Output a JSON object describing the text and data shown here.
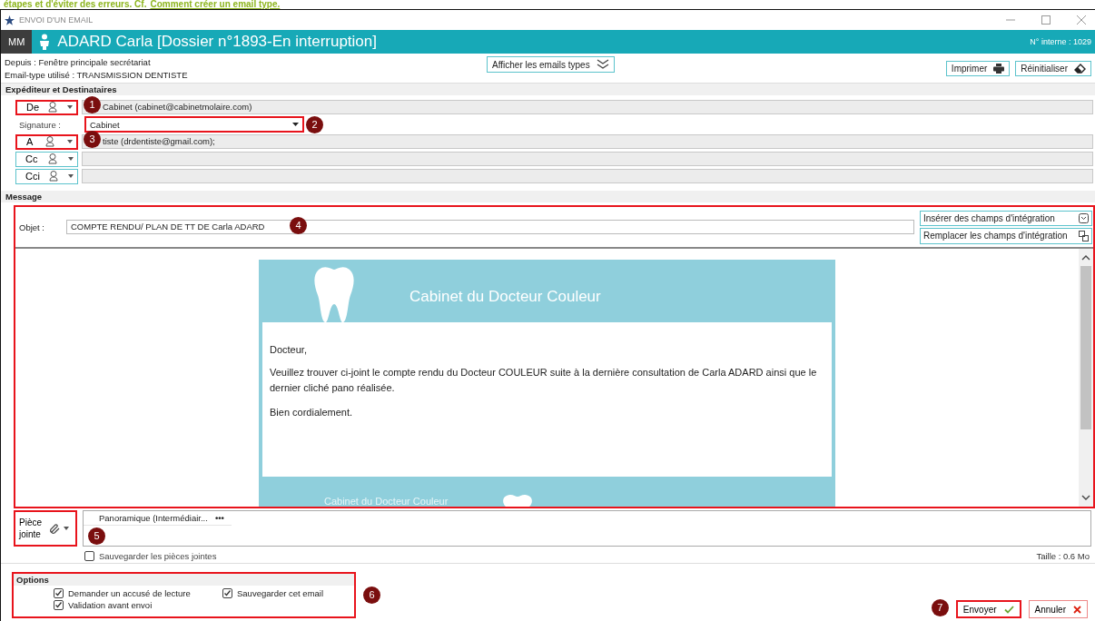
{
  "note": {
    "text": "étapes et d'éviter des erreurs. Cf.",
    "link": "Comment créer un email type."
  },
  "window": {
    "title": "ENVOI D'UN EMAIL"
  },
  "header": {
    "initials": "MM",
    "patient": "ADARD Carla [Dossier n°1893-En interruption]",
    "internal_number": "N° interne :  1029"
  },
  "info": {
    "source": "Depuis : Fenêtre principale secrétariat",
    "template": "Email-type utilisé : TRANSMISSION DENTISTE"
  },
  "toolbar": {
    "templates_button": "Afficher les emails types",
    "print_button": "Imprimer",
    "reset_button": "Réinitialiser"
  },
  "recipients": {
    "title": "Expéditeur et Destinataires",
    "rows": [
      {
        "kind": "address",
        "label": "De",
        "value": "Cabinet (cabinet@cabinetmolaire.com)",
        "highlighted": true,
        "marker": "1"
      },
      {
        "kind": "select",
        "label": "Signature :",
        "value": "Cabinet",
        "highlighted": true,
        "marker": "2"
      },
      {
        "kind": "address",
        "label": "A",
        "value": "tiste (drdentiste@gmail.com);",
        "highlighted": true,
        "marker": "3"
      },
      {
        "kind": "address",
        "label": "Cc",
        "highlighted": false
      },
      {
        "kind": "address",
        "label": "Cci",
        "highlighted": false
      }
    ]
  },
  "message": {
    "title": "Message",
    "subject_label": "Objet :",
    "subject": "COMPTE RENDU/ PLAN DE TT DE Carla ADARD",
    "marker": "4",
    "insert_button": "Insérer des champs d'intégration",
    "replace_button": "Remplacer les champs d'intégration",
    "email": {
      "banner": "Cabinet du Docteur Couleur",
      "greeting": "Docteur,",
      "body": "Veuillez trouver ci-joint le compte rendu du Docteur COULEUR suite à la dernière consultation de Carla ADARD ainsi que le dernier cliché pano réalisée.",
      "closing": "Bien cordialement.",
      "footer": "Cabinet du Docteur Couleur"
    }
  },
  "attachments": {
    "label": "Pièce jointe",
    "marker": "5",
    "files": [
      "Panoramique (Intermédiair..."
    ],
    "more": "•••",
    "save": {
      "label": "Sauvegarder les pièces jointes",
      "checked": false
    },
    "size": "Taille : 0.6 Mo"
  },
  "options": {
    "title": "Options",
    "marker": "6",
    "items": [
      {
        "label": "Demander un accusé de lecture",
        "checked": true
      },
      {
        "label": "Sauvegarder cet email",
        "checked": true
      },
      {
        "label": "Validation avant envoi",
        "checked": true
      }
    ]
  },
  "actions": {
    "marker": "7",
    "send": "Envoyer",
    "cancel": "Annuler"
  }
}
